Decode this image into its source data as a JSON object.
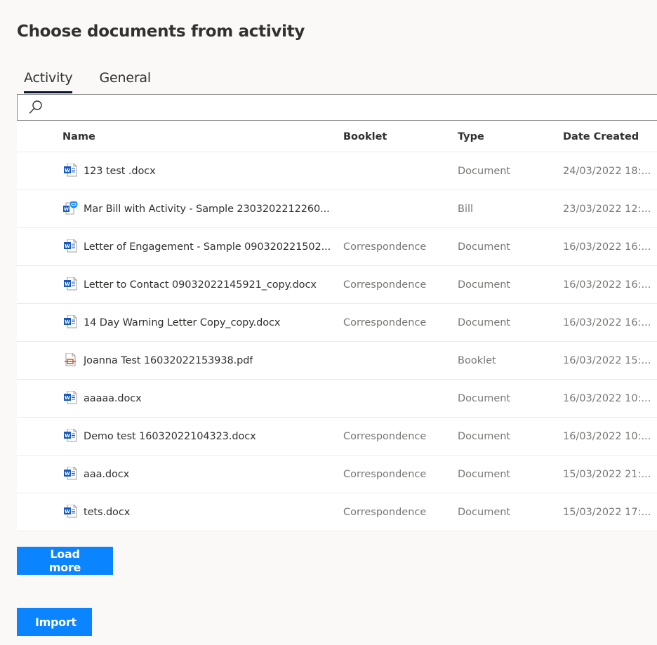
{
  "page": {
    "title": "Choose documents from activity"
  },
  "tabs": [
    {
      "label": "Activity",
      "active": true
    },
    {
      "label": "General",
      "active": false
    }
  ],
  "search": {
    "value": "",
    "placeholder": "",
    "icon": "search-icon"
  },
  "grid": {
    "columns": {
      "name": "Name",
      "booklet": "Booklet",
      "type": "Type",
      "date": "Date Created"
    },
    "rows": [
      {
        "icon": "word-doc-icon",
        "name": "123 test .docx",
        "booklet": "",
        "type": "Document",
        "date": "24/03/2022 18:..."
      },
      {
        "icon": "word-bill-icon",
        "name": "Mar Bill with Activity - Sample 2303202212260...",
        "booklet": "",
        "type": "Bill",
        "date": "23/03/2022 12:..."
      },
      {
        "icon": "word-doc-icon",
        "name": "Letter of Engagement - Sample 090320221502...",
        "booklet": "Correspondence",
        "type": "Document",
        "date": "16/03/2022 16:..."
      },
      {
        "icon": "word-doc-icon",
        "name": "Letter to Contact 09032022145921_copy.docx",
        "booklet": "Correspondence",
        "type": "Document",
        "date": "16/03/2022 16:..."
      },
      {
        "icon": "word-doc-icon",
        "name": "14 Day Warning Letter Copy_copy.docx",
        "booklet": "Correspondence",
        "type": "Document",
        "date": "16/03/2022 16:..."
      },
      {
        "icon": "pdf-booklet-icon",
        "name": "Joanna Test 16032022153938.pdf",
        "booklet": "",
        "type": "Booklet",
        "date": "16/03/2022 15:..."
      },
      {
        "icon": "word-doc-icon",
        "name": "aaaaa.docx",
        "booklet": "",
        "type": "Document",
        "date": "16/03/2022 10:..."
      },
      {
        "icon": "word-doc-icon",
        "name": "Demo test 16032022104323.docx",
        "booklet": "Correspondence",
        "type": "Document",
        "date": "16/03/2022 10:..."
      },
      {
        "icon": "word-doc-icon",
        "name": "aaa.docx",
        "booklet": "Correspondence",
        "type": "Document",
        "date": "15/03/2022 21:..."
      },
      {
        "icon": "word-doc-icon",
        "name": "tets.docx",
        "booklet": "Correspondence",
        "type": "Document",
        "date": "15/03/2022 17:..."
      }
    ]
  },
  "buttons": {
    "load_more": "Load more",
    "import": "Import"
  },
  "colors": {
    "primary": "#0a84ff",
    "word_blue": "#185abd",
    "pdf_red": "#d9541e",
    "tab_underline": "#0b1530"
  }
}
